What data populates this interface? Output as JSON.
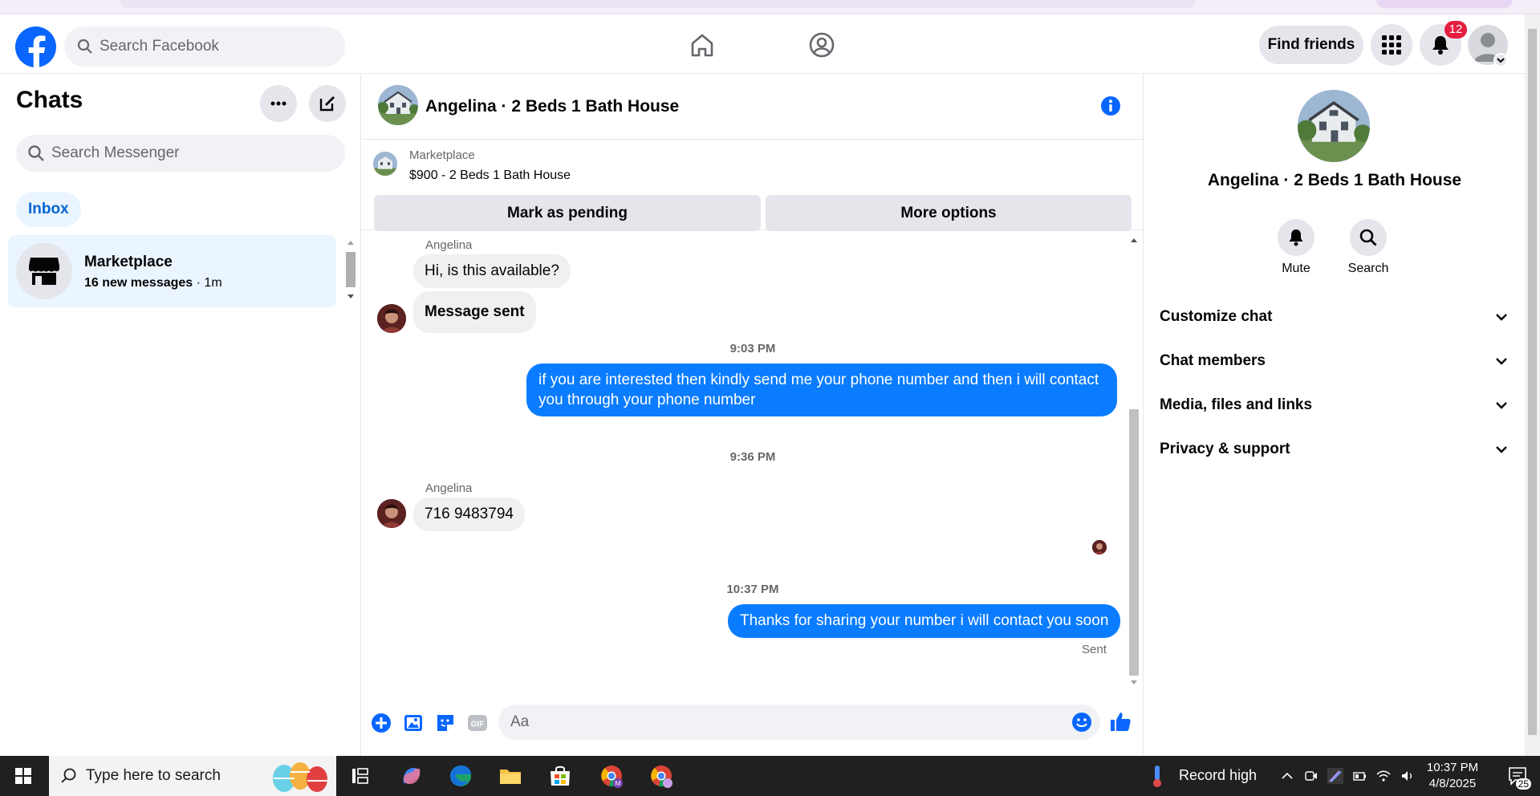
{
  "fb": {
    "search_placeholder": "Search Facebook",
    "find_friends": "Find friends",
    "notification_count": "12"
  },
  "sidebar": {
    "title": "Chats",
    "search_placeholder": "Search Messenger",
    "inbox_label": "Inbox",
    "chat": {
      "name": "Marketplace",
      "preview": "16 new messages",
      "time": "1m"
    }
  },
  "chat": {
    "title": "Angelina · 2 Beds 1 Bath House",
    "listing_source": "Marketplace",
    "listing_title": "$900 - 2 Beds 1 Bath House",
    "mark_pending": "Mark as pending",
    "more_options": "More options",
    "messages": {
      "sender1": "Angelina",
      "m1": "Hi, is this available?",
      "m2": "Message sent",
      "ts1": "9:03 PM",
      "m3": "if you are interested then kindly send me your phone number and then i will contact you through your phone number",
      "ts2": "9:36 PM",
      "sender2": "Angelina",
      "m4": "716 9483794",
      "ts3": "10:37 PM",
      "m5": "Thanks for sharing your number i will contact you soon",
      "status": "Sent"
    },
    "composer_placeholder": "Aa"
  },
  "info_panel": {
    "name": "Angelina · 2 Beds 1 Bath House",
    "mute_label": "Mute",
    "search_label": "Search",
    "sections": [
      "Customize chat",
      "Chat members",
      "Media, files and links",
      "Privacy & support"
    ]
  },
  "taskbar": {
    "search_placeholder": "Type here to search",
    "weather": "Record high",
    "time": "10:37 PM",
    "date": "4/8/2025",
    "notif_count": "25"
  },
  "colors": {
    "fb_blue": "#0866ff",
    "bubble_out": "#0a7cff",
    "bubble_in": "#f0f0f0",
    "badge_red": "#e41e3f"
  }
}
